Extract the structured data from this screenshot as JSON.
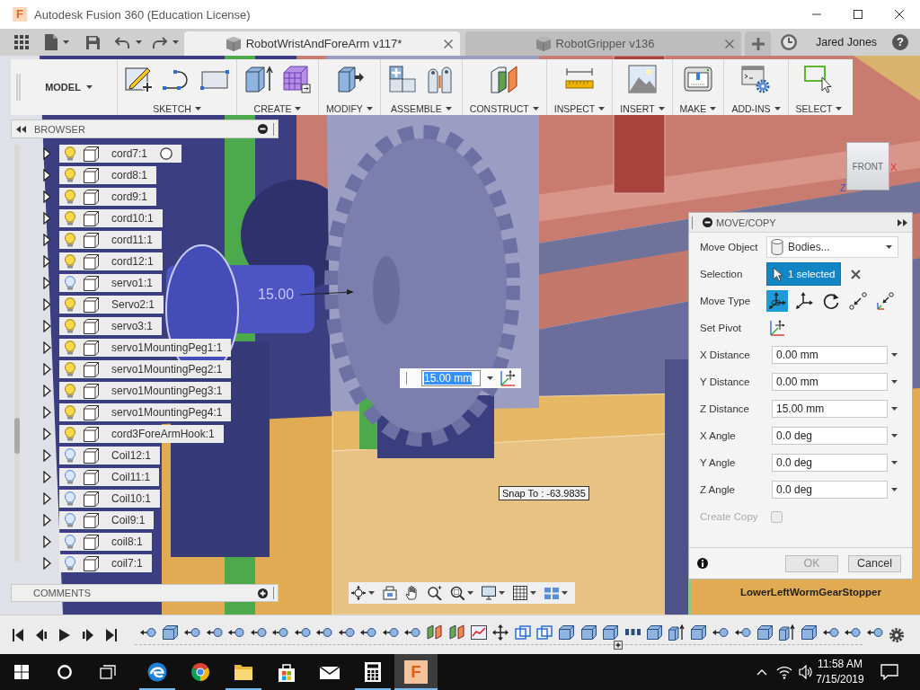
{
  "window": {
    "logo": "F",
    "title": "Autodesk Fusion 360 (Education License)"
  },
  "tab_bar": {
    "tabs": [
      {
        "label": "RobotWristAndForeArm v117*",
        "selected": true
      },
      {
        "label": "RobotGripper v136",
        "selected": false
      }
    ],
    "user": "Jared Jones",
    "help": "?"
  },
  "toolbar": {
    "workspace": "MODEL",
    "groups": [
      {
        "label": "SKETCH"
      },
      {
        "label": "CREATE"
      },
      {
        "label": "MODIFY"
      },
      {
        "label": "ASSEMBLE"
      },
      {
        "label": "CONSTRUCT"
      },
      {
        "label": "INSPECT"
      },
      {
        "label": "INSERT"
      },
      {
        "label": "MAKE"
      },
      {
        "label": "ADD-INS"
      },
      {
        "label": "SELECT"
      }
    ]
  },
  "browser": {
    "title": "BROWSER",
    "items": [
      {
        "name": "cord7:1",
        "visible": true,
        "expanded": false,
        "hovered": true
      },
      {
        "name": "cord8:1",
        "visible": true,
        "expanded": false,
        "hovered": false
      },
      {
        "name": "cord9:1",
        "visible": true,
        "expanded": false,
        "hovered": false
      },
      {
        "name": "cord10:1",
        "visible": true,
        "expanded": false,
        "hovered": false
      },
      {
        "name": "cord11:1",
        "visible": true,
        "expanded": false,
        "hovered": false
      },
      {
        "name": "cord12:1",
        "visible": true,
        "expanded": false,
        "hovered": false
      },
      {
        "name": "servo1:1",
        "visible": false,
        "expanded": false,
        "hovered": false
      },
      {
        "name": "Servo2:1",
        "visible": true,
        "expanded": false,
        "hovered": false
      },
      {
        "name": "servo3:1",
        "visible": true,
        "expanded": false,
        "hovered": false
      },
      {
        "name": "servo1MountingPeg1:1",
        "visible": true,
        "expanded": false,
        "hovered": false
      },
      {
        "name": "servo1MountingPeg2:1",
        "visible": true,
        "expanded": false,
        "hovered": false
      },
      {
        "name": "servo1MountingPeg3:1",
        "visible": true,
        "expanded": false,
        "hovered": false
      },
      {
        "name": "servo1MountingPeg4:1",
        "visible": true,
        "expanded": false,
        "hovered": false
      },
      {
        "name": "cord3ForeArmHook:1",
        "visible": true,
        "expanded": false,
        "hovered": false
      },
      {
        "name": "Coil12:1",
        "visible": false,
        "expanded": false,
        "hovered": false
      },
      {
        "name": "Coil11:1",
        "visible": false,
        "expanded": false,
        "hovered": false
      },
      {
        "name": "Coil10:1",
        "visible": false,
        "expanded": false,
        "hovered": false
      },
      {
        "name": "Coil9:1",
        "visible": false,
        "expanded": false,
        "hovered": false
      },
      {
        "name": "coil8:1",
        "visible": false,
        "expanded": false,
        "hovered": false
      },
      {
        "name": "coil7:1",
        "visible": false,
        "expanded": false,
        "hovered": false
      }
    ]
  },
  "comments": {
    "title": "COMMENTS"
  },
  "viewport": {
    "dimension": "15.00",
    "value_input": "15.00 mm",
    "snap_tooltip": "Snap To : -63.9835",
    "view_cube": {
      "face": "FRONT",
      "axis_x": "X",
      "axis_z": "Z"
    },
    "selected_body": "LowerLeftWormGearStopper"
  },
  "move_copy": {
    "title": "MOVE/COPY",
    "move_object": {
      "label": "Move Object",
      "value": "Bodies..."
    },
    "selection": {
      "label": "Selection",
      "value": "1 selected"
    },
    "move_type": {
      "label": "Move Type",
      "options": [
        {
          "kind": "free",
          "selected": true
        },
        {
          "kind": "translate",
          "selected": false
        },
        {
          "kind": "rotate",
          "selected": false
        },
        {
          "kind": "point-to-point",
          "selected": false
        },
        {
          "kind": "point-to-position",
          "selected": false
        }
      ]
    },
    "pivot": {
      "label": "Set Pivot"
    },
    "fields": [
      {
        "label": "X Distance",
        "value": "0.00 mm"
      },
      {
        "label": "Y Distance",
        "value": "0.00 mm"
      },
      {
        "label": "Z Distance",
        "value": "15.00 mm"
      },
      {
        "label": "X Angle",
        "value": "0.0 deg"
      },
      {
        "label": "Y Angle",
        "value": "0.0 deg"
      },
      {
        "label": "Z Angle",
        "value": "0.0 deg"
      }
    ],
    "create_copy": {
      "label": "Create Copy",
      "checked": false,
      "disabled": true
    },
    "buttons": [
      {
        "label": "OK",
        "disabled": true
      },
      {
        "label": "Cancel",
        "disabled": false
      }
    ]
  },
  "timeline": {
    "features": [
      {
        "kind": "joint"
      },
      {
        "kind": "component"
      },
      {
        "kind": "joint"
      },
      {
        "kind": "joint"
      },
      {
        "kind": "joint"
      },
      {
        "kind": "joint"
      },
      {
        "kind": "joint"
      },
      {
        "kind": "joint"
      },
      {
        "kind": "joint"
      },
      {
        "kind": "joint"
      },
      {
        "kind": "joint"
      },
      {
        "kind": "joint"
      },
      {
        "kind": "joint"
      },
      {
        "kind": "plane"
      },
      {
        "kind": "plane"
      },
      {
        "kind": "sketch"
      },
      {
        "kind": "move"
      },
      {
        "kind": "combine"
      },
      {
        "kind": "combine"
      },
      {
        "kind": "component"
      },
      {
        "kind": "component"
      },
      {
        "kind": "component"
      },
      {
        "kind": "pattern"
      },
      {
        "kind": "component"
      },
      {
        "kind": "extrude"
      },
      {
        "kind": "component"
      },
      {
        "kind": "joint"
      },
      {
        "kind": "joint"
      },
      {
        "kind": "component"
      },
      {
        "kind": "extrude"
      },
      {
        "kind": "component"
      },
      {
        "kind": "joint"
      },
      {
        "kind": "joint"
      },
      {
        "kind": "joint"
      }
    ]
  },
  "taskbar": {
    "apps": [
      {
        "kind": "edge",
        "running": true,
        "selected": false
      },
      {
        "kind": "chrome",
        "running": false,
        "selected": false
      },
      {
        "kind": "explorer",
        "running": true,
        "selected": false
      },
      {
        "kind": "store",
        "running": false,
        "selected": false
      },
      {
        "kind": "mail",
        "running": false,
        "selected": false
      },
      {
        "kind": "calculator",
        "running": true,
        "selected": false
      },
      {
        "kind": "fusion",
        "running": true,
        "selected": true,
        "letter": "F"
      }
    ],
    "time": "11:58 AM",
    "date": "7/15/2019"
  }
}
